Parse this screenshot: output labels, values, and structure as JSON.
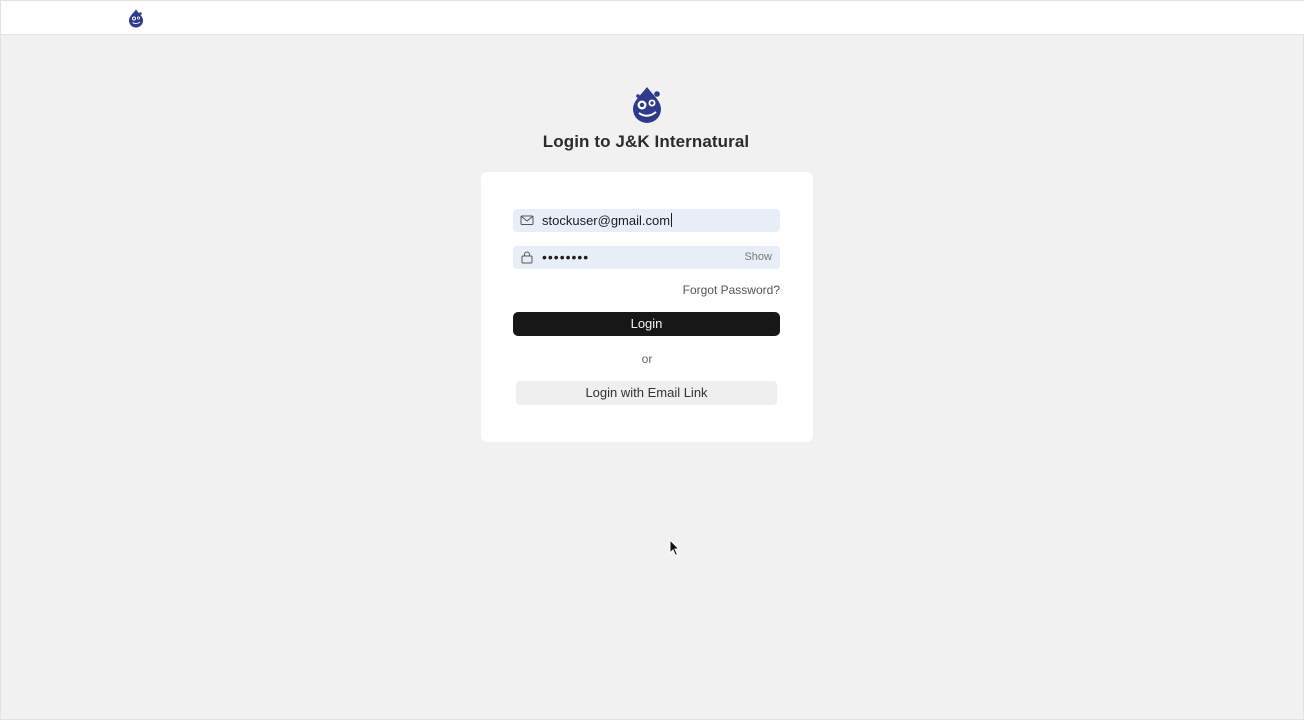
{
  "page": {
    "title": "Login to J&K Internatural"
  },
  "form": {
    "email": {
      "value": "stockuser@gmail.com"
    },
    "password": {
      "masked_value": "••••••••",
      "show_label": "Show"
    },
    "forgot_label": "Forgot Password?",
    "login_label": "Login",
    "divider_label": "or",
    "email_link_label": "Login with Email Link"
  },
  "icons": {
    "brand": "brand-logo-icon",
    "email": "mail-icon",
    "password": "lock-icon",
    "cursor": "mouse-pointer-icon"
  },
  "colors": {
    "brand": "#2e3a8c",
    "field_bg": "#e8eef8",
    "primary_button": "#171717",
    "page_bg": "#f1f1f1"
  }
}
